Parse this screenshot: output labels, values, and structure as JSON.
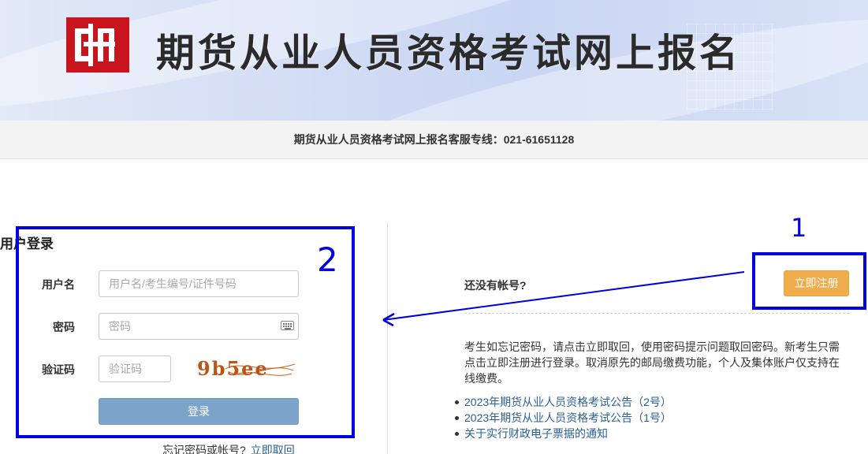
{
  "header": {
    "title": "期货从业人员资格考试网上报名",
    "hotline": "期货从业人员资格考试网上报名客服专线：021-61651128"
  },
  "login": {
    "title": "用户登录",
    "username_label": "用户名",
    "username_placeholder": "用户名/考生编号/证件号码",
    "password_label": "密码",
    "password_placeholder": "密码",
    "captcha_label": "验证码",
    "captcha_placeholder": "验证码",
    "captcha_text": "9b5ee",
    "login_button": "登录",
    "forgot_text": "忘记密码或帐号?",
    "retrieve_link": "立即取回"
  },
  "register": {
    "no_account": "还没有帐号?",
    "register_button": "立即注册",
    "notice": "考生如忘记密码，请点击立即取回，使用密码提示问题取回密码。新考生只需点击立即注册进行登录。取消原先的邮局缴费功能，个人及集体账户仅支持在线缴费。"
  },
  "announcements": [
    "2023年期货从业人员资格考试公告（2号）",
    "2023年期货从业人员资格考试公告（1号）",
    "关于实行财政电子票据的通知"
  ],
  "annotations": {
    "label_1": "1",
    "label_2": "2"
  },
  "colors": {
    "logo_red": "#c8151d",
    "register_orange": "#f0ad4e",
    "login_blue": "#7ca3c9",
    "link_blue": "#2a5f95",
    "annotation_blue": "#0000e0"
  }
}
